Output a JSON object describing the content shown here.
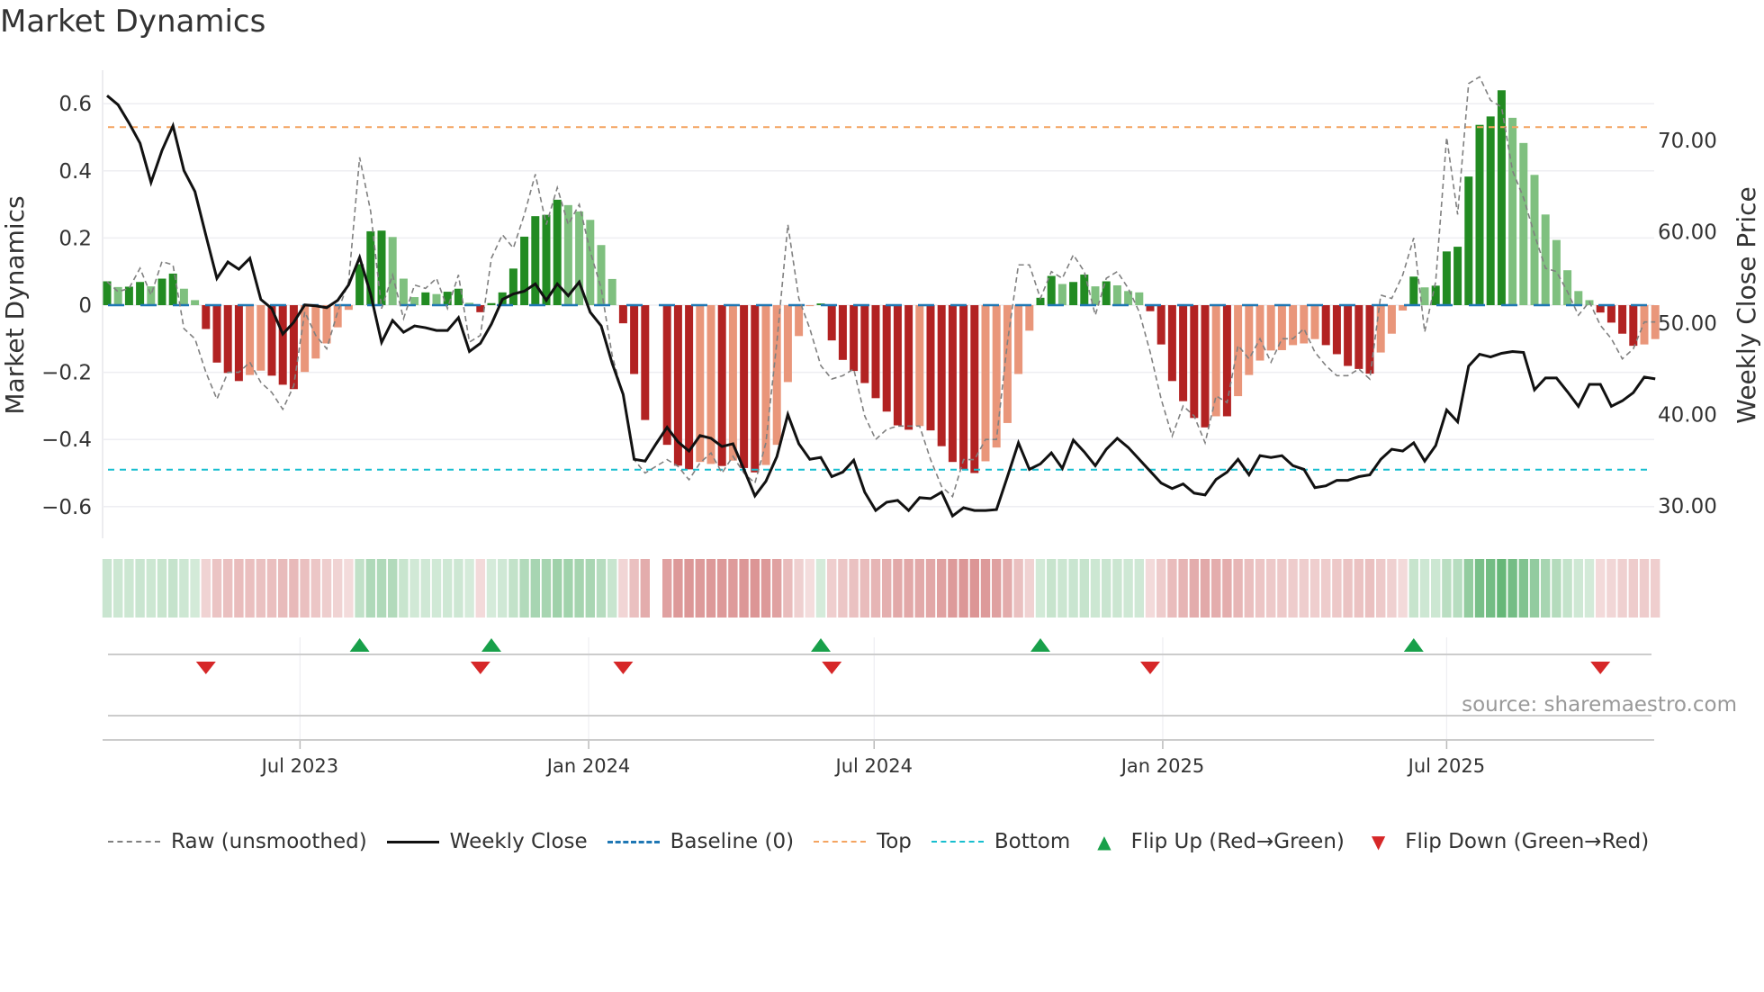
{
  "title": "Market Dynamics",
  "source": "source: sharemaestro.com",
  "colors": {
    "green_strong": "#228b22",
    "green_light": "#7fc07f",
    "red_strong": "#b22222",
    "red_light": "#e9967a",
    "raw": "#808080",
    "close": "#111111",
    "baseline": "#1f77b4",
    "top": "#f4a460",
    "bottom": "#17becf",
    "flip_up": "#18a04a",
    "flip_down": "#d62728"
  },
  "legend": [
    {
      "label": "Raw (unsmoothed)",
      "kind": "raw"
    },
    {
      "label": "Weekly Close",
      "kind": "close"
    },
    {
      "label": "Baseline (0)",
      "kind": "baseline"
    },
    {
      "label": "Top",
      "kind": "top"
    },
    {
      "label": "Bottom",
      "kind": "bottom"
    },
    {
      "label": "Flip Up (Red→Green)",
      "kind": "up"
    },
    {
      "label": "Flip Down (Green→Red)",
      "kind": "down"
    }
  ],
  "chart_data": {
    "type": "bar",
    "title": "Market Dynamics",
    "ylabel": "Market Dynamics",
    "y2label": "Weekly Close Price",
    "ylim": [
      -0.7,
      0.7
    ],
    "y2lim": [
      25.7,
      78.7
    ],
    "yticks": [
      "0.6",
      "0.4",
      "0.2",
      "0",
      "−0.2",
      "−0.4",
      "−0.6"
    ],
    "ytick_values": [
      0.6,
      0.4,
      0.2,
      0,
      -0.2,
      -0.4,
      -0.6
    ],
    "y2ticks": [
      "70.00",
      "60.00",
      "50.00",
      "40.00",
      "30.00"
    ],
    "y2tick_values": [
      70,
      60,
      50,
      40,
      30
    ],
    "xticks": [
      "Jul 2023",
      "Jan 2024",
      "Jul 2024",
      "Jan 2025",
      "Jul 2025"
    ],
    "xtick_dates": [
      "2023-07-01",
      "2024-01-01",
      "2024-07-01",
      "2025-01-01",
      "2025-07-01"
    ],
    "x_start": "2023-02-28",
    "x_step_days": 7,
    "baseline": 0,
    "top_threshold": 0.53,
    "bottom_threshold": -0.49,
    "dynamics": [
      0.071,
      0.054,
      0.055,
      0.069,
      0.056,
      0.079,
      0.094,
      0.049,
      0.015,
      -0.071,
      -0.171,
      -0.202,
      -0.226,
      -0.208,
      -0.195,
      -0.21,
      -0.237,
      -0.25,
      -0.199,
      -0.159,
      -0.114,
      -0.066,
      -0.014,
      0.122,
      0.22,
      0.222,
      0.203,
      0.079,
      0.024,
      0.038,
      0.033,
      0.04,
      0.049,
      0.007,
      -0.021,
      0.006,
      0.038,
      0.109,
      0.204,
      0.265,
      0.269,
      0.314,
      0.298,
      0.279,
      0.254,
      0.179,
      0.078,
      -0.054,
      -0.205,
      -0.342,
      null,
      -0.416,
      -0.478,
      -0.489,
      -0.467,
      -0.473,
      -0.479,
      -0.463,
      -0.485,
      -0.498,
      -0.476,
      -0.416,
      -0.229,
      -0.092,
      -0.003,
      0.005,
      -0.105,
      -0.163,
      -0.196,
      -0.232,
      -0.277,
      -0.317,
      -0.358,
      -0.371,
      -0.36,
      -0.373,
      -0.42,
      -0.467,
      -0.489,
      -0.5,
      -0.465,
      -0.424,
      -0.351,
      -0.205,
      -0.076,
      0.022,
      0.087,
      0.063,
      0.069,
      0.091,
      0.056,
      0.071,
      0.059,
      0.042,
      0.038,
      -0.018,
      -0.117,
      -0.226,
      -0.286,
      -0.336,
      -0.364,
      -0.331,
      -0.331,
      -0.271,
      -0.208,
      -0.165,
      -0.135,
      -0.134,
      -0.119,
      -0.114,
      -0.101,
      -0.119,
      -0.146,
      -0.181,
      -0.19,
      -0.204,
      -0.141,
      -0.085,
      -0.016,
      0.085,
      0.053,
      0.058,
      0.16,
      0.174,
      0.383,
      0.537,
      0.562,
      0.64,
      0.558,
      0.483,
      0.388,
      0.27,
      0.194,
      0.104,
      0.042,
      0.015,
      -0.022,
      -0.052,
      -0.085,
      -0.121,
      -0.117,
      -0.101
    ],
    "strong": [
      1,
      0,
      1,
      1,
      0,
      1,
      1,
      0,
      0,
      1,
      1,
      1,
      1,
      0,
      0,
      1,
      1,
      1,
      0,
      0,
      0,
      0,
      0,
      1,
      1,
      1,
      0,
      0,
      0,
      1,
      0,
      1,
      1,
      0,
      1,
      1,
      1,
      1,
      1,
      1,
      1,
      1,
      0,
      0,
      0,
      0,
      0,
      1,
      1,
      1,
      0,
      1,
      1,
      1,
      0,
      0,
      1,
      0,
      1,
      1,
      0,
      0,
      0,
      0,
      0,
      1,
      1,
      1,
      1,
      1,
      1,
      1,
      1,
      1,
      0,
      1,
      1,
      1,
      1,
      1,
      0,
      0,
      0,
      0,
      0,
      1,
      1,
      0,
      1,
      1,
      0,
      1,
      0,
      0,
      0,
      1,
      1,
      1,
      1,
      1,
      1,
      0,
      1,
      0,
      0,
      0,
      0,
      0,
      0,
      0,
      0,
      1,
      1,
      1,
      1,
      1,
      0,
      0,
      0,
      1,
      0,
      1,
      1,
      1,
      1,
      1,
      1,
      1,
      0,
      0,
      0,
      0,
      0,
      0,
      0,
      0,
      1,
      1,
      1,
      1,
      0,
      0
    ],
    "raw": [
      0.07,
      0.04,
      0.05,
      0.11,
      0.03,
      0.13,
      0.12,
      -0.07,
      -0.1,
      -0.2,
      -0.28,
      -0.2,
      -0.2,
      -0.17,
      -0.23,
      -0.26,
      -0.31,
      -0.24,
      -0.02,
      -0.09,
      -0.13,
      -0.02,
      0.07,
      0.44,
      0.28,
      -0.01,
      0.09,
      -0.04,
      0.06,
      0.05,
      0.08,
      -0.01,
      0.09,
      -0.11,
      -0.09,
      0.14,
      0.21,
      0.17,
      0.27,
      0.39,
      0.24,
      0.35,
      0.24,
      0.3,
      0.16,
      0.05,
      -0.15,
      -0.27,
      -0.46,
      -0.5,
      -0.48,
      -0.46,
      -0.48,
      -0.52,
      -0.47,
      -0.44,
      -0.5,
      -0.45,
      -0.5,
      -0.53,
      -0.41,
      -0.11,
      0.24,
      0.02,
      -0.07,
      -0.18,
      -0.22,
      -0.21,
      -0.19,
      -0.33,
      -0.4,
      -0.37,
      -0.36,
      -0.36,
      -0.36,
      -0.46,
      -0.54,
      -0.57,
      -0.46,
      -0.46,
      -0.4,
      -0.4,
      -0.11,
      0.12,
      0.12,
      0.02,
      0.1,
      0.08,
      0.15,
      0.1,
      -0.03,
      0.08,
      0.1,
      0.05,
      -0.02,
      -0.14,
      -0.28,
      -0.39,
      -0.3,
      -0.33,
      -0.41,
      -0.27,
      -0.29,
      -0.12,
      -0.16,
      -0.1,
      -0.17,
      -0.1,
      -0.1,
      -0.07,
      -0.14,
      -0.18,
      -0.21,
      -0.21,
      -0.19,
      -0.22,
      0.03,
      0.02,
      0.09,
      0.2,
      -0.08,
      0.07,
      0.5,
      0.27,
      0.66,
      0.68,
      0.61,
      0.59,
      0.4,
      0.32,
      0.21,
      0.11,
      0.1,
      0.04,
      -0.03,
      0.01,
      -0.06,
      -0.1,
      -0.16,
      -0.13,
      -0.05,
      -0.05
    ],
    "close": [
      74.9,
      73.9,
      71.9,
      69.7,
      65.4,
      68.9,
      71.6,
      66.7,
      64.4,
      59.6,
      54.9,
      56.7,
      55.9,
      57.1,
      52.6,
      51.6,
      48.8,
      50.1,
      52.0,
      51.9,
      51.7,
      52.5,
      54.2,
      57.2,
      53.2,
      47.9,
      50.3,
      49.0,
      49.7,
      49.5,
      49.2,
      49.2,
      50.6,
      46.9,
      47.8,
      49.9,
      52.6,
      53.2,
      53.5,
      54.3,
      52.5,
      54.3,
      53.0,
      54.5,
      51.2,
      49.7,
      45.6,
      42.2,
      35.1,
      34.9,
      36.8,
      38.6,
      37.0,
      36.0,
      37.7,
      37.4,
      36.5,
      36.8,
      34.0,
      31.1,
      32.7,
      35.4,
      40.0,
      36.8,
      35.1,
      35.3,
      33.2,
      33.7,
      35.0,
      31.5,
      29.5,
      30.4,
      30.6,
      29.5,
      30.9,
      30.8,
      31.5,
      28.9,
      29.8,
      29.5,
      29.5,
      29.6,
      33.2,
      36.9,
      34.0,
      34.6,
      35.8,
      34.1,
      37.2,
      35.9,
      34.4,
      36.2,
      37.4,
      36.4,
      35.1,
      33.8,
      32.5,
      31.9,
      32.4,
      31.4,
      31.2,
      32.9,
      33.7,
      35.1,
      33.4,
      35.5,
      35.3,
      35.5,
      34.4,
      34.0,
      32.0,
      32.2,
      32.8,
      32.8,
      33.2,
      33.4,
      35.1,
      36.2,
      36.0,
      36.9,
      34.9,
      36.6,
      40.5,
      39.2,
      45.3,
      46.6,
      46.3,
      46.7,
      46.9,
      46.8,
      42.7,
      44.0,
      44.0,
      42.5,
      40.9,
      43.3,
      43.3,
      40.9,
      41.5,
      42.4,
      44.1,
      43.9
    ],
    "flip_up": [
      23,
      35,
      65,
      85,
      119
    ],
    "flip_down": [
      9,
      34,
      47,
      66,
      95,
      136
    ]
  }
}
